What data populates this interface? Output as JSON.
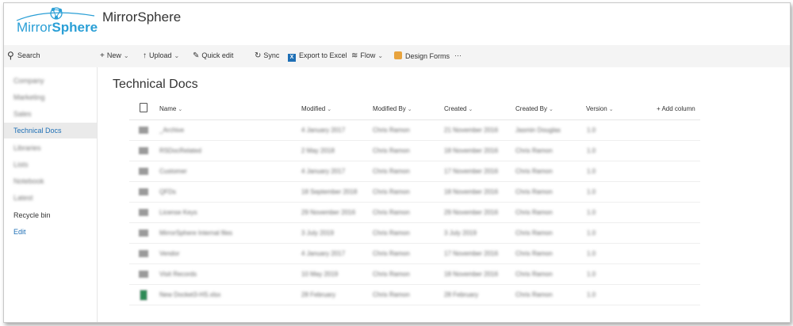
{
  "header": {
    "logo_text_part1": "Mirror",
    "logo_text_part2": "Sphere",
    "site_title": "MirrorSphere"
  },
  "search": {
    "label": "Search",
    "icon": "search-icon"
  },
  "commands": [
    {
      "label": "New",
      "icon": "plus-icon",
      "dropdown": true
    },
    {
      "label": "Upload",
      "icon": "upload-icon",
      "dropdown": true
    },
    {
      "label": "Quick edit",
      "icon": "pencil-icon",
      "dropdown": false
    },
    {
      "label": "Sync",
      "icon": "sync-icon",
      "dropdown": false
    },
    {
      "label": "Export to Excel",
      "icon": "excel-icon",
      "dropdown": false
    },
    {
      "label": "Flow",
      "icon": "flow-icon",
      "dropdown": true
    },
    {
      "label": "Design Forms",
      "icon": "forms-icon",
      "dropdown": false
    },
    {
      "label": "···",
      "icon": "more-icon",
      "dropdown": false
    }
  ],
  "sidebar": {
    "items": [
      {
        "label": "Company",
        "blurred": true
      },
      {
        "label": "Marketing",
        "blurred": true
      },
      {
        "label": "Sales",
        "blurred": true
      },
      {
        "label": "Technical Docs",
        "selected": true
      },
      {
        "label": "Libraries",
        "blurred": true
      },
      {
        "label": "Lists",
        "blurred": true
      },
      {
        "label": "Notebook",
        "blurred": true
      },
      {
        "label": "Latest",
        "blurred": true
      },
      {
        "label": "Recycle bin"
      },
      {
        "label": "Edit",
        "link": true
      }
    ]
  },
  "main": {
    "title": "Technical Docs",
    "columns": {
      "name": "Name",
      "modified": "Modified",
      "modified_by": "Modified By",
      "created": "Created",
      "created_by": "Created By",
      "version": "Version",
      "add": "+ Add column"
    },
    "rows": [
      {
        "type": "folder",
        "name": "_Archive",
        "modified": "4 January 2017",
        "modified_by": "Chris Ramon",
        "created": "21 November 2016",
        "created_by": "Jasmin Douglas",
        "version": "1.0"
      },
      {
        "type": "folder",
        "name": "RSDocRelated",
        "modified": "2 May 2018",
        "modified_by": "Chris Ramon",
        "created": "18 November 2016",
        "created_by": "Chris Ramon",
        "version": "1.0"
      },
      {
        "type": "folder",
        "name": "Customer",
        "modified": "4 January 2017",
        "modified_by": "Chris Ramon",
        "created": "17 November 2016",
        "created_by": "Chris Ramon",
        "version": "1.0"
      },
      {
        "type": "folder",
        "name": "QFDs",
        "modified": "18 September 2018",
        "modified_by": "Chris Ramon",
        "created": "18 November 2016",
        "created_by": "Chris Ramon",
        "version": "1.0"
      },
      {
        "type": "folder",
        "name": "License Keys",
        "modified": "29 November 2016",
        "modified_by": "Chris Ramon",
        "created": "29 November 2016",
        "created_by": "Chris Ramon",
        "version": "1.0"
      },
      {
        "type": "folder",
        "name": "MirrorSphere Internal files",
        "modified": "3 July 2019",
        "modified_by": "Chris Ramon",
        "created": "3 July 2019",
        "created_by": "Chris Ramon",
        "version": "1.0"
      },
      {
        "type": "folder",
        "name": "Vendor",
        "modified": "4 January 2017",
        "modified_by": "Chris Ramon",
        "created": "17 November 2016",
        "created_by": "Chris Ramon",
        "version": "1.0"
      },
      {
        "type": "folder",
        "name": "Visit Records",
        "modified": "10 May 2019",
        "modified_by": "Chris Ramon",
        "created": "18 November 2016",
        "created_by": "Chris Ramon",
        "version": "1.0"
      },
      {
        "type": "file",
        "name": "New Docket3-HS.xlsx",
        "modified": "28 February",
        "modified_by": "Chris Ramon",
        "created": "28 February",
        "created_by": "Chris Ramon",
        "version": "1.0"
      }
    ]
  },
  "colors": {
    "brand": "#2a9fd6",
    "accent": "#1e6fb5",
    "bar": "#f4f4f4",
    "selected": "#eaeaea"
  }
}
